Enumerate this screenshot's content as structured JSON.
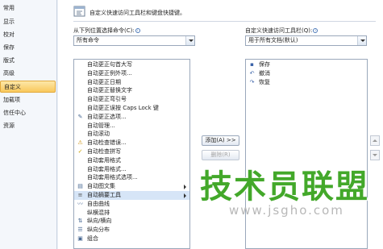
{
  "sidebar": {
    "items": [
      {
        "label": "常用"
      },
      {
        "label": "显示"
      },
      {
        "label": "校对"
      },
      {
        "label": "保存"
      },
      {
        "label": "版式"
      },
      {
        "label": "高级"
      },
      {
        "label": "自定义",
        "active": true
      },
      {
        "label": "加载项"
      },
      {
        "label": "信任中心"
      },
      {
        "label": "资源"
      }
    ]
  },
  "header": {
    "icon": "toolbar-customize-icon",
    "text": "自定义快速访问工具栏和键盘快捷键。"
  },
  "left_panel": {
    "label": "从下列位置选择命令(C):",
    "combo_value": "所有命令",
    "list": [
      {
        "label": "自动更正句首大写",
        "icon": ""
      },
      {
        "label": "自动更正例外项...",
        "icon": ""
      },
      {
        "label": "自动更正日期",
        "icon": ""
      },
      {
        "label": "自动更正替换文字",
        "icon": ""
      },
      {
        "label": "自动更正弯引号",
        "icon": ""
      },
      {
        "label": "自动更正误按 Caps Lock 键",
        "icon": ""
      },
      {
        "label": "自动更正选项...",
        "icon": "autocorrect-icon"
      },
      {
        "label": "自动管理...",
        "icon": ""
      },
      {
        "label": "自动滚动",
        "icon": ""
      },
      {
        "label": "自动检查错误...",
        "icon": "check-errors-icon"
      },
      {
        "label": "自动检查拼写",
        "icon": "spellcheck-icon"
      },
      {
        "label": "自动套用格式",
        "icon": ""
      },
      {
        "label": "自动套用格式...",
        "icon": ""
      },
      {
        "label": "自动套用格式选项...",
        "icon": ""
      },
      {
        "label": "自动图文集",
        "icon": "autotext-icon",
        "submenu": true
      },
      {
        "label": "自动摘要工具",
        "icon": "summary-icon",
        "submenu": true,
        "selected": true
      },
      {
        "label": "自由曲线",
        "icon": "freeform-icon"
      },
      {
        "label": "纵横混排",
        "icon": ""
      },
      {
        "label": "纵向/横向",
        "icon": "orientation-icon"
      },
      {
        "label": "纵向分布",
        "icon": "distribute-vertical-icon"
      },
      {
        "label": "组合",
        "icon": "group-icon"
      }
    ]
  },
  "buttons": {
    "add": "添加(A) >>",
    "remove": "删除(R)"
  },
  "right_panel": {
    "label": "自定义快速访问工具栏(Q):",
    "combo_value": "用于所有文档(默认)",
    "list": [
      {
        "label": "保存",
        "icon": "save-icon"
      },
      {
        "label": "撤消",
        "icon": "undo-icon"
      },
      {
        "label": "恢复",
        "icon": "redo-icon"
      }
    ]
  },
  "watermark": {
    "big": "技术员联盟",
    "small": "www.jsgho.com"
  },
  "colors": {
    "active_nav": "#f9c85c",
    "watermark": "#43a82a",
    "selection": "#d6e5f7"
  }
}
